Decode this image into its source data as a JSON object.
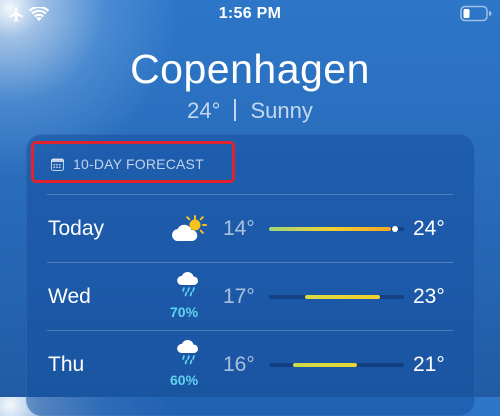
{
  "status_bar": {
    "time": "1:56 PM",
    "icons": [
      "airplane-icon",
      "wifi-icon",
      "battery-icon"
    ]
  },
  "location": {
    "city": "Copenhagen",
    "temperature": "24°",
    "condition": "Sunny"
  },
  "forecast": {
    "header": "10-DAY FORECAST",
    "header_icon": "calendar-icon",
    "days": [
      {
        "day": "Today",
        "icon": "partly-sunny-icon",
        "precip": "",
        "low": "14°",
        "high": "24°",
        "range_start": 0.0,
        "range_end": 0.9,
        "current_marker": 0.93,
        "range_colors": [
          "#9fd57a",
          "#f3d233",
          "#f5a623"
        ]
      },
      {
        "day": "Wed",
        "icon": "rain-cloud-icon",
        "precip": "70%",
        "low": "17°",
        "high": "23°",
        "range_start": 0.27,
        "range_end": 0.82,
        "range_colors": [
          "#d6dc43",
          "#f2cf2b"
        ]
      },
      {
        "day": "Thu",
        "icon": "rain-cloud-icon",
        "precip": "60%",
        "low": "16°",
        "high": "21°",
        "range_start": 0.18,
        "range_end": 0.65,
        "range_colors": [
          "#c9dc4a",
          "#e9d534"
        ]
      }
    ]
  }
}
